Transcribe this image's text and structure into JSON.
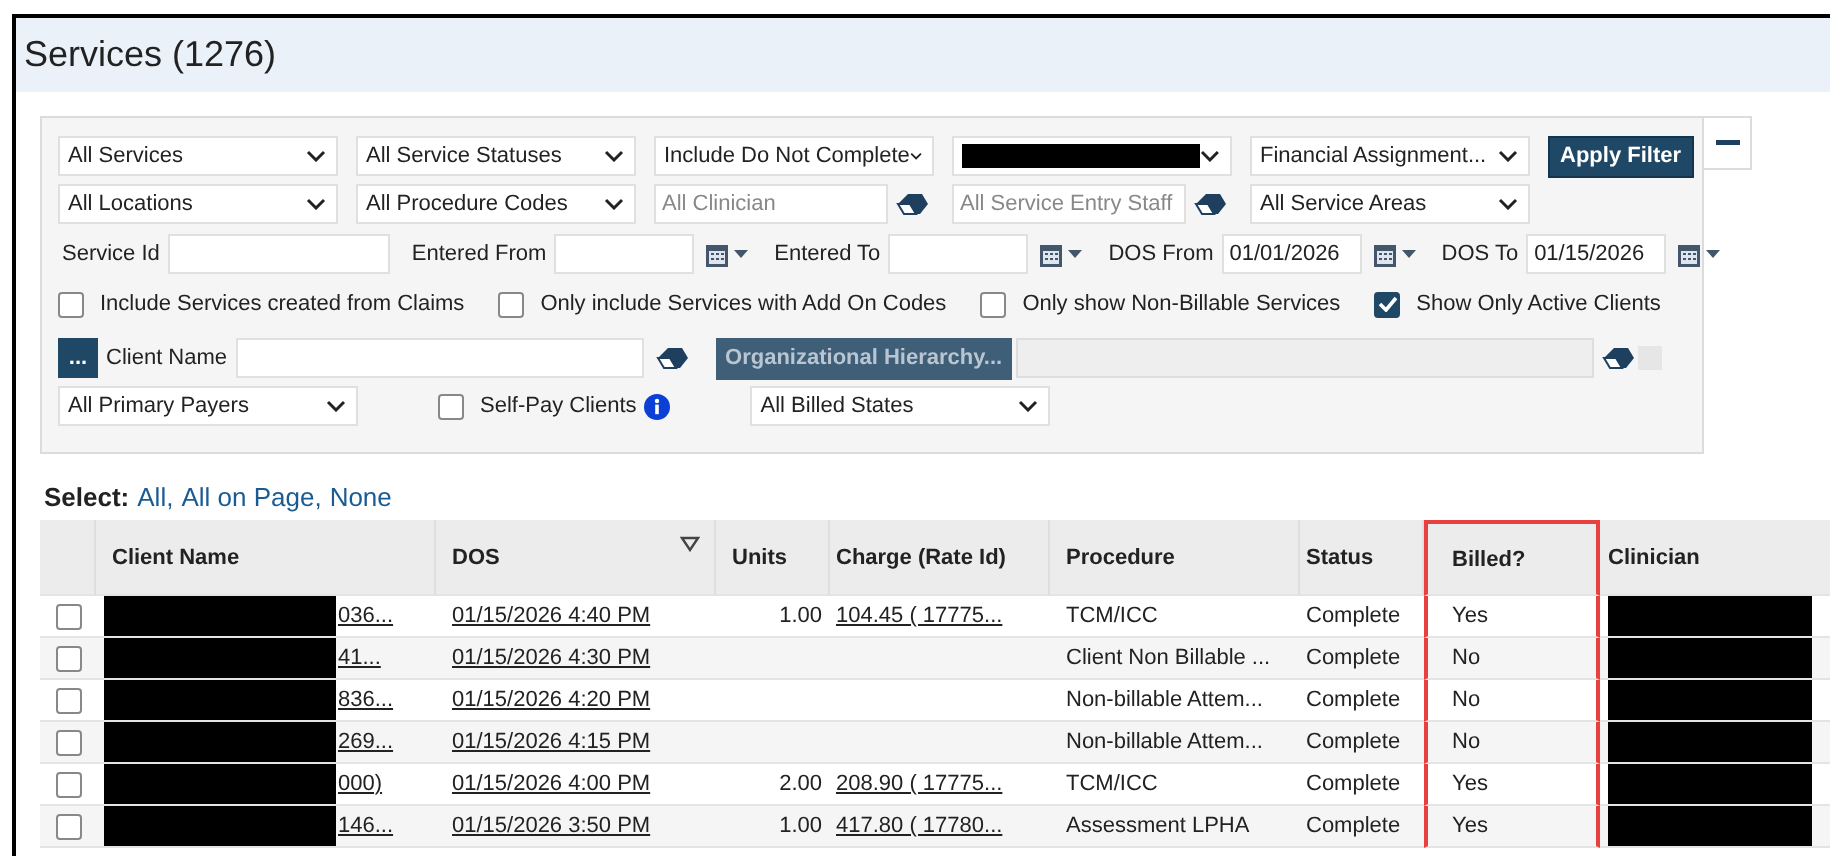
{
  "title": "Services (1276)",
  "filters": {
    "top_rows": [
      [
        {
          "kind": "select",
          "value": "All Services"
        },
        {
          "kind": "select",
          "value": "All Service Statuses"
        },
        {
          "kind": "select",
          "value": "Include Do Not Complete"
        },
        {
          "kind": "select",
          "redacted": true
        },
        {
          "kind": "select",
          "value": "Financial Assignment..."
        },
        {
          "kind": "button",
          "label": "Apply Filter"
        }
      ],
      [
        {
          "kind": "select",
          "value": "All Locations"
        },
        {
          "kind": "select",
          "value": "All Procedure Codes"
        },
        {
          "kind": "lookup",
          "placeholder": "All Clinician"
        },
        {
          "kind": "lookup",
          "placeholder": "All Service Entry Staff"
        },
        {
          "kind": "select",
          "value": "All Service Areas"
        }
      ]
    ],
    "date_fields": [
      {
        "kind": "field",
        "label": "Service Id"
      },
      {
        "kind": "date",
        "label": "Entered From"
      },
      {
        "kind": "date",
        "label": "Entered To"
      },
      {
        "kind": "date",
        "label": "DOS From",
        "value": "01/01/2026"
      },
      {
        "kind": "date",
        "label": "DOS To",
        "value": "01/15/2026"
      }
    ],
    "checkboxes": [
      {
        "label": "Include Services created from Claims",
        "checked": false
      },
      {
        "label": "Only include Services with Add On Codes",
        "checked": false
      },
      {
        "label": "Only show Non-Billable Services",
        "checked": false
      },
      {
        "label": "Show Only Active Clients",
        "checked": true
      }
    ],
    "client_picker": {
      "button_label": "...",
      "label": "Client Name"
    },
    "hierarchy_button": "Organizational Hierarchy...",
    "primary_payers": "All Primary Payers",
    "self_pay": {
      "label": "Self-Pay Clients",
      "checked": false,
      "info": true
    },
    "billed_states": "All Billed States"
  },
  "select": {
    "label": "Select:",
    "links": [
      "All,",
      "All on Page,",
      "None"
    ]
  },
  "table": {
    "columns": [
      {
        "kind": "checkbox",
        "sorted": false,
        "highlighted": false
      },
      {
        "kind": "redacted_link",
        "label": "Client Name",
        "sorted": false,
        "highlighted": false
      },
      {
        "kind": "link",
        "label": "DOS",
        "sorted": true,
        "highlighted": false
      },
      {
        "kind": "number",
        "label": "Units",
        "sorted": false,
        "highlighted": false
      },
      {
        "kind": "link",
        "label": "Charge (Rate Id)",
        "sorted": false,
        "highlighted": false
      },
      {
        "kind": "text",
        "label": "Procedure",
        "sorted": false,
        "highlighted": false
      },
      {
        "kind": "text",
        "label": "Status",
        "sorted": false,
        "highlighted": false
      },
      {
        "kind": "text",
        "label": "Billed?",
        "sorted": false,
        "highlighted": true
      },
      {
        "kind": "redacted",
        "label": "Clinician",
        "sorted": false,
        "highlighted": false
      }
    ],
    "rows": [
      {
        "cells": [
          {
            "checked": false
          },
          "036...",
          "01/15/2026 4:40 PM",
          "1.00",
          "104.45 ( 17775...",
          "TCM/ICC",
          "Complete",
          "Yes"
        ]
      },
      {
        "cells": [
          {
            "checked": false
          },
          "41...",
          "01/15/2026 4:30 PM",
          null,
          null,
          "Client Non Billable ...",
          "Complete",
          "No"
        ]
      },
      {
        "cells": [
          {
            "checked": false
          },
          "836...",
          "01/15/2026 4:20 PM",
          null,
          null,
          "Non-billable Attem...",
          "Complete",
          "No"
        ]
      },
      {
        "cells": [
          {
            "checked": false
          },
          "269...",
          "01/15/2026 4:15 PM",
          null,
          null,
          "Non-billable Attem...",
          "Complete",
          "No"
        ]
      },
      {
        "cells": [
          {
            "checked": false
          },
          "000)",
          "01/15/2026 4:00 PM",
          "2.00",
          "208.90 ( 17775...",
          "TCM/ICC",
          "Complete",
          "Yes"
        ]
      },
      {
        "cells": [
          {
            "checked": false
          },
          "146...",
          "01/15/2026 3:50 PM",
          "1.00",
          "417.80 ( 17780...",
          "Assessment LPHA",
          "Complete",
          "Yes"
        ]
      }
    ]
  }
}
